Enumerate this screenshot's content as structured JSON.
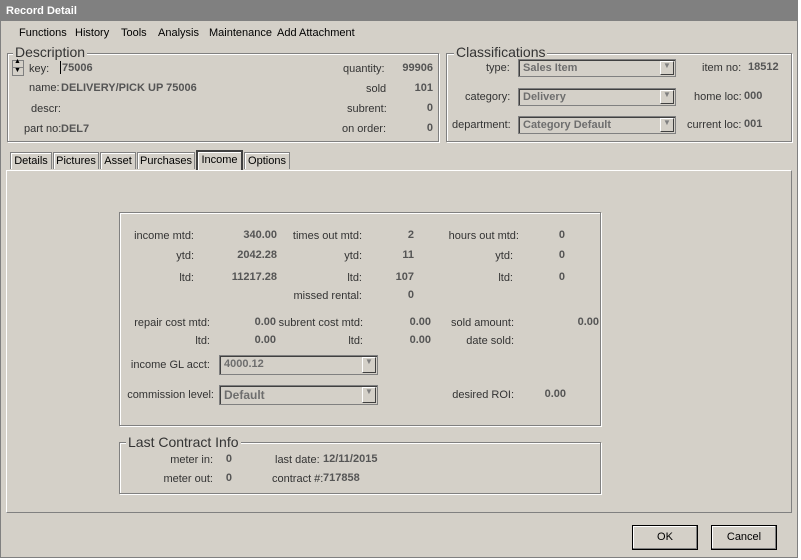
{
  "window": {
    "title": "Record Detail"
  },
  "menu": [
    "Functions",
    "History",
    "Tools",
    "Analysis",
    "Maintenance",
    "Add Attachment"
  ],
  "description": {
    "title": "Description",
    "key_label": "key:",
    "key_value": "75006",
    "name_label": "name:",
    "name_value": "DELIVERY/PICK UP 75006",
    "descr_label": "descr:",
    "partno_label": "part no:",
    "partno_value": "DEL7",
    "quantity_label": "quantity:",
    "quantity_value": "99906",
    "sold_label": "sold",
    "sold_value": "101",
    "subrent_label": "subrent:",
    "subrent_value": "0",
    "onorder_label": "on order:",
    "onorder_value": "0"
  },
  "classifications": {
    "title": "Classifications",
    "type_label": "type:",
    "type_value": "Sales Item",
    "category_label": "category:",
    "category_value": "Delivery",
    "department_label": "department:",
    "department_value": "Category Default",
    "itemno_label": "item no:",
    "itemno_value": "18512",
    "homeloc_label": "home loc:",
    "homeloc_value": "000",
    "currentloc_label": "current loc:",
    "currentloc_value": "001"
  },
  "tabs": [
    "Details",
    "Pictures",
    "Asset",
    "Purchases",
    "Income",
    "Options"
  ],
  "income": {
    "income_mtd_label": "income mtd:",
    "income_mtd": "340.00",
    "income_ytd_label": "ytd:",
    "income_ytd": "2042.28",
    "income_ltd_label": "ltd:",
    "income_ltd": "11217.28",
    "times_out_mtd_label": "times out mtd:",
    "times_out_mtd": "2",
    "times_out_ytd_label": "ytd:",
    "times_out_ytd": "11",
    "times_out_ltd_label": "ltd:",
    "times_out_ltd": "107",
    "missed_rental_label": "missed rental:",
    "missed_rental": "0",
    "hours_out_mtd_label": "hours out mtd:",
    "hours_out_mtd": "0",
    "hours_out_ytd_label": "ytd:",
    "hours_out_ytd": "0",
    "hours_out_ltd_label": "ltd:",
    "hours_out_ltd": "0",
    "repair_cost_mtd_label": "repair cost mtd:",
    "repair_cost_mtd": "0.00",
    "repair_cost_ltd_label": "ltd:",
    "repair_cost_ltd": "0.00",
    "subrent_cost_mtd_label": "subrent cost mtd:",
    "subrent_cost_mtd": "0.00",
    "subrent_cost_ltd_label": "ltd:",
    "subrent_cost_ltd": "0.00",
    "sold_amount_label": "sold amount:",
    "sold_amount": "0.00",
    "date_sold_label": "date sold:",
    "income_gl_label": "income GL acct:",
    "income_gl": "4000.12",
    "commission_label": "commission level:",
    "commission": "Default",
    "desired_roi_label": "desired ROI:",
    "desired_roi": "0.00"
  },
  "last_contract": {
    "title": "Last Contract Info",
    "meter_in_label": "meter in:",
    "meter_in": "0",
    "meter_out_label": "meter out:",
    "meter_out": "0",
    "last_date_label": "last date:",
    "last_date": "12/11/2015",
    "contract_label": "contract #:",
    "contract": "717858"
  },
  "buttons": {
    "ok": "OK",
    "cancel": "Cancel"
  }
}
